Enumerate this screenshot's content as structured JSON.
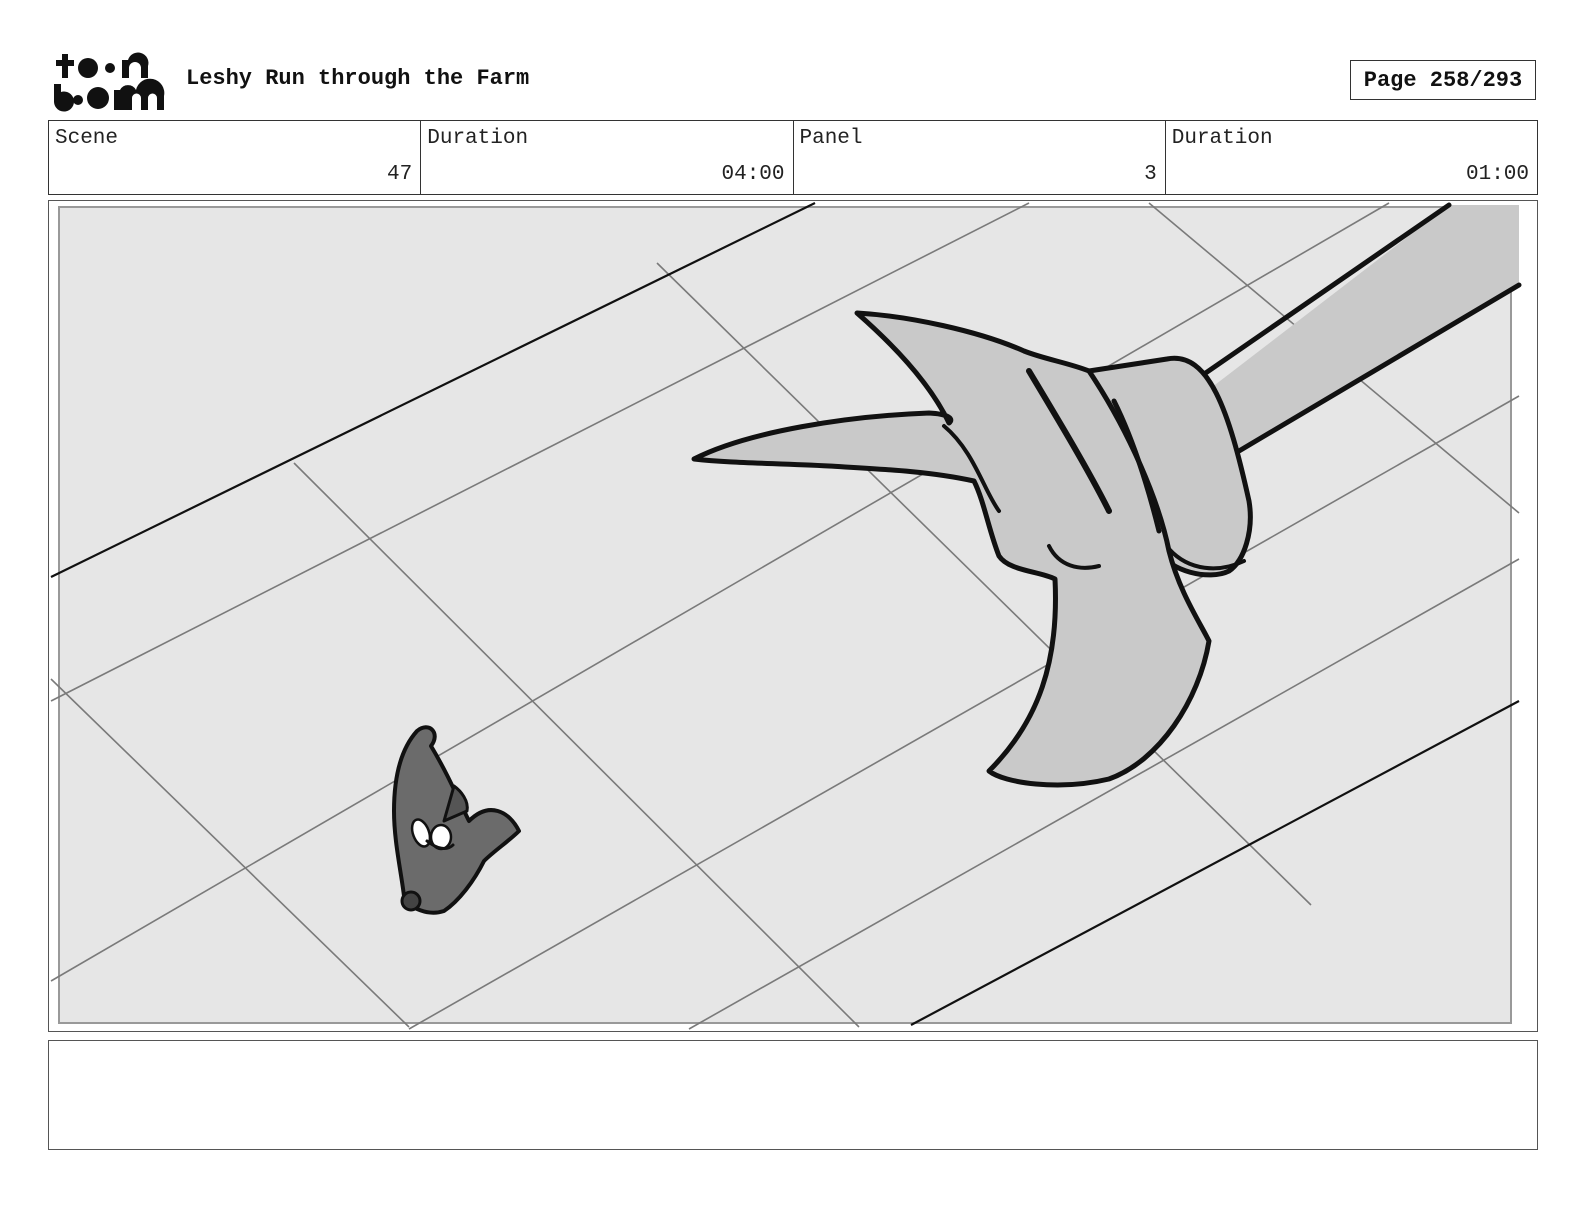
{
  "header": {
    "logo_text_top": "toon",
    "logo_text_bottom": "boom",
    "title": "Leshy Run through the Farm",
    "page_label": "Page 258/293"
  },
  "info": [
    {
      "label": "Scene",
      "value": "47"
    },
    {
      "label": "Duration",
      "value": "04:00"
    },
    {
      "label": "Panel",
      "value": "3"
    },
    {
      "label": "Duration",
      "value": "01:00"
    }
  ],
  "panel": {
    "colors": {
      "floor": "#e6e6e6",
      "creature": "#c9c9c9",
      "leshy": "#6b6b6b",
      "line": "#111111",
      "grid": "#777777"
    }
  },
  "notes": {
    "text": ""
  }
}
